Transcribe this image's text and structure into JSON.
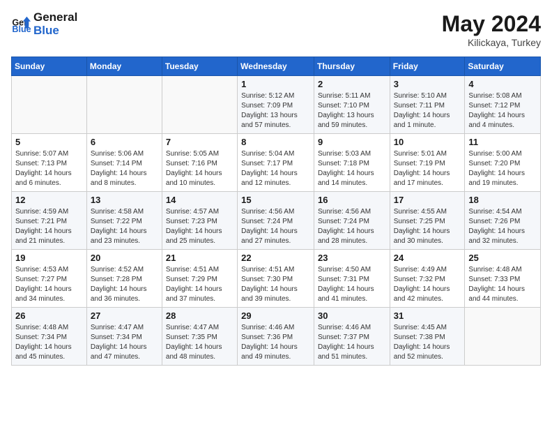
{
  "header": {
    "logo_line1": "General",
    "logo_line2": "Blue",
    "month": "May 2024",
    "location": "Kilickaya, Turkey"
  },
  "weekdays": [
    "Sunday",
    "Monday",
    "Tuesday",
    "Wednesday",
    "Thursday",
    "Friday",
    "Saturday"
  ],
  "weeks": [
    [
      {
        "day": "",
        "info": ""
      },
      {
        "day": "",
        "info": ""
      },
      {
        "day": "",
        "info": ""
      },
      {
        "day": "1",
        "info": "Sunrise: 5:12 AM\nSunset: 7:09 PM\nDaylight: 13 hours and 57 minutes."
      },
      {
        "day": "2",
        "info": "Sunrise: 5:11 AM\nSunset: 7:10 PM\nDaylight: 13 hours and 59 minutes."
      },
      {
        "day": "3",
        "info": "Sunrise: 5:10 AM\nSunset: 7:11 PM\nDaylight: 14 hours and 1 minute."
      },
      {
        "day": "4",
        "info": "Sunrise: 5:08 AM\nSunset: 7:12 PM\nDaylight: 14 hours and 4 minutes."
      }
    ],
    [
      {
        "day": "5",
        "info": "Sunrise: 5:07 AM\nSunset: 7:13 PM\nDaylight: 14 hours and 6 minutes."
      },
      {
        "day": "6",
        "info": "Sunrise: 5:06 AM\nSunset: 7:14 PM\nDaylight: 14 hours and 8 minutes."
      },
      {
        "day": "7",
        "info": "Sunrise: 5:05 AM\nSunset: 7:16 PM\nDaylight: 14 hours and 10 minutes."
      },
      {
        "day": "8",
        "info": "Sunrise: 5:04 AM\nSunset: 7:17 PM\nDaylight: 14 hours and 12 minutes."
      },
      {
        "day": "9",
        "info": "Sunrise: 5:03 AM\nSunset: 7:18 PM\nDaylight: 14 hours and 14 minutes."
      },
      {
        "day": "10",
        "info": "Sunrise: 5:01 AM\nSunset: 7:19 PM\nDaylight: 14 hours and 17 minutes."
      },
      {
        "day": "11",
        "info": "Sunrise: 5:00 AM\nSunset: 7:20 PM\nDaylight: 14 hours and 19 minutes."
      }
    ],
    [
      {
        "day": "12",
        "info": "Sunrise: 4:59 AM\nSunset: 7:21 PM\nDaylight: 14 hours and 21 minutes."
      },
      {
        "day": "13",
        "info": "Sunrise: 4:58 AM\nSunset: 7:22 PM\nDaylight: 14 hours and 23 minutes."
      },
      {
        "day": "14",
        "info": "Sunrise: 4:57 AM\nSunset: 7:23 PM\nDaylight: 14 hours and 25 minutes."
      },
      {
        "day": "15",
        "info": "Sunrise: 4:56 AM\nSunset: 7:24 PM\nDaylight: 14 hours and 27 minutes."
      },
      {
        "day": "16",
        "info": "Sunrise: 4:56 AM\nSunset: 7:24 PM\nDaylight: 14 hours and 28 minutes."
      },
      {
        "day": "17",
        "info": "Sunrise: 4:55 AM\nSunset: 7:25 PM\nDaylight: 14 hours and 30 minutes."
      },
      {
        "day": "18",
        "info": "Sunrise: 4:54 AM\nSunset: 7:26 PM\nDaylight: 14 hours and 32 minutes."
      }
    ],
    [
      {
        "day": "19",
        "info": "Sunrise: 4:53 AM\nSunset: 7:27 PM\nDaylight: 14 hours and 34 minutes."
      },
      {
        "day": "20",
        "info": "Sunrise: 4:52 AM\nSunset: 7:28 PM\nDaylight: 14 hours and 36 minutes."
      },
      {
        "day": "21",
        "info": "Sunrise: 4:51 AM\nSunset: 7:29 PM\nDaylight: 14 hours and 37 minutes."
      },
      {
        "day": "22",
        "info": "Sunrise: 4:51 AM\nSunset: 7:30 PM\nDaylight: 14 hours and 39 minutes."
      },
      {
        "day": "23",
        "info": "Sunrise: 4:50 AM\nSunset: 7:31 PM\nDaylight: 14 hours and 41 minutes."
      },
      {
        "day": "24",
        "info": "Sunrise: 4:49 AM\nSunset: 7:32 PM\nDaylight: 14 hours and 42 minutes."
      },
      {
        "day": "25",
        "info": "Sunrise: 4:48 AM\nSunset: 7:33 PM\nDaylight: 14 hours and 44 minutes."
      }
    ],
    [
      {
        "day": "26",
        "info": "Sunrise: 4:48 AM\nSunset: 7:34 PM\nDaylight: 14 hours and 45 minutes."
      },
      {
        "day": "27",
        "info": "Sunrise: 4:47 AM\nSunset: 7:34 PM\nDaylight: 14 hours and 47 minutes."
      },
      {
        "day": "28",
        "info": "Sunrise: 4:47 AM\nSunset: 7:35 PM\nDaylight: 14 hours and 48 minutes."
      },
      {
        "day": "29",
        "info": "Sunrise: 4:46 AM\nSunset: 7:36 PM\nDaylight: 14 hours and 49 minutes."
      },
      {
        "day": "30",
        "info": "Sunrise: 4:46 AM\nSunset: 7:37 PM\nDaylight: 14 hours and 51 minutes."
      },
      {
        "day": "31",
        "info": "Sunrise: 4:45 AM\nSunset: 7:38 PM\nDaylight: 14 hours and 52 minutes."
      },
      {
        "day": "",
        "info": ""
      }
    ]
  ]
}
